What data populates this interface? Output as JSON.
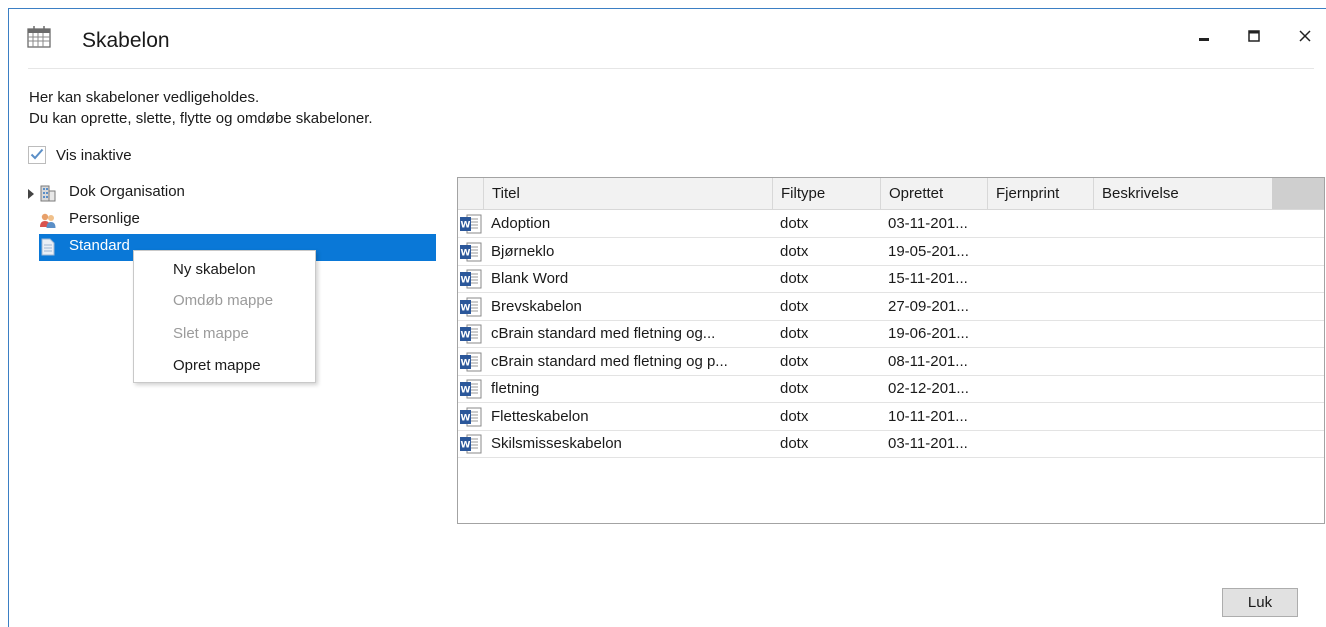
{
  "window": {
    "title": "Skabelon",
    "app_icon": "calendar-grid-icon",
    "controls": [
      "minimize-icon",
      "maximize-icon",
      "close-icon"
    ]
  },
  "description": {
    "line1": "Her kan skabeloner vedligeholdes.",
    "line2": "Du kan oprette, slette, flytte og omdøbe skabeloner."
  },
  "show_inactive": {
    "label": "Vis inaktive",
    "checked": true
  },
  "tree": {
    "items": [
      {
        "label": "Dok Organisation",
        "icon": "building-icon",
        "expandable": true
      },
      {
        "label": "Personlige",
        "icon": "users-icon",
        "expandable": false
      },
      {
        "label": "Standard",
        "icon": "document-icon",
        "expandable": false,
        "selected": true
      }
    ]
  },
  "context_menu": {
    "items": [
      {
        "label": "Ny skabelon",
        "enabled": true
      },
      {
        "label": "Omdøb mappe",
        "enabled": false
      },
      {
        "label": "Slet mappe",
        "enabled": false
      },
      {
        "label": "Opret mappe",
        "enabled": true
      }
    ]
  },
  "table": {
    "columns": [
      "Titel",
      "Filtype",
      "Oprettet",
      "Fjernprint",
      "Beskrivelse"
    ],
    "rows": [
      [
        "Adoption",
        "dotx",
        "03-11-201...",
        "",
        ""
      ],
      [
        "Bjørneklo",
        "dotx",
        "19-05-201...",
        "",
        ""
      ],
      [
        "Blank Word",
        "dotx",
        "15-11-201...",
        "",
        ""
      ],
      [
        "Brevskabelon",
        "dotx",
        "27-09-201...",
        "",
        ""
      ],
      [
        "cBrain standard med fletning og...",
        "dotx",
        "19-06-201...",
        "",
        ""
      ],
      [
        "cBrain standard med fletning og p...",
        "dotx",
        "08-11-201...",
        "",
        ""
      ],
      [
        "fletning",
        "dotx",
        "02-12-201...",
        "",
        ""
      ],
      [
        "Fletteskabelon",
        "dotx",
        "10-11-201...",
        "",
        ""
      ],
      [
        "Skilsmisseskabelon",
        "dotx",
        "03-11-201...",
        "",
        ""
      ]
    ],
    "row_icon": "word-document-icon"
  },
  "footer": {
    "close_label": "Luk"
  },
  "colors": {
    "accent": "#0a78d7",
    "selection": "#0a78d7",
    "word_blue": "#2b579a"
  }
}
